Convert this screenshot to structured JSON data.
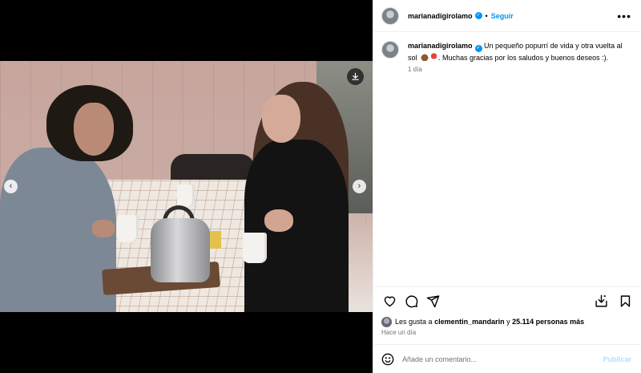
{
  "post": {
    "username": "marianadigirolamo",
    "separator": "•",
    "follow_label": "Seguir",
    "more_label": "•••",
    "caption_before_emoji": "Un pequeño popurrí de vida y otra vuelta al sol",
    "caption_after_emoji": ". Muchas gracias por los saludos y buenos deseos :).",
    "caption_time": "1 día",
    "verified_mark": "✓"
  },
  "media": {
    "prev_label": "‹",
    "next_label": "›"
  },
  "likes": {
    "prefix": "Les gusta a",
    "user": "clementin_mandarin",
    "connector": "y",
    "count_text": "25.114 personas más",
    "time_ago": "Hace un día"
  },
  "comment": {
    "placeholder": "Añade un comentario...",
    "publish_label": "Publicar"
  },
  "icons": [
    "download-icon",
    "heart-icon",
    "comment-icon",
    "share-icon",
    "save-post-icon",
    "bookmark-icon",
    "emoji-icon",
    "more-icon",
    "chevron-left-icon",
    "chevron-right-icon"
  ],
  "colors": {
    "accent": "#0095f6",
    "publish_disabled": "#b2dffc",
    "muted": "#737373"
  }
}
